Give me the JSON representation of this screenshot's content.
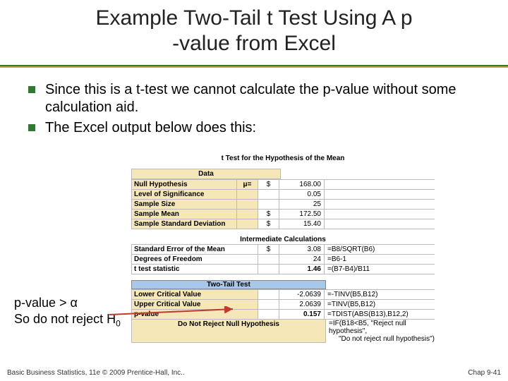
{
  "title_line1": "Example Two-Tail t Test Using A  p",
  "title_line2": "-value from Excel",
  "bullets": [
    "Since this is a t-test we cannot calculate the p-value without some calculation aid.",
    "The Excel output below does this:"
  ],
  "excel": {
    "sec1_title": "t Test for the Hypothesis of the Mean",
    "data_label": "Data",
    "rows1": [
      {
        "label": "Null Hypothesis",
        "sym": "μ=",
        "dollar": "$",
        "val": "168.00",
        "formula": ""
      },
      {
        "label": "Level of Significance",
        "sym": "",
        "dollar": "",
        "val": "0.05",
        "formula": ""
      },
      {
        "label": "Sample Size",
        "sym": "",
        "dollar": "",
        "val": "25",
        "formula": ""
      },
      {
        "label": "Sample Mean",
        "sym": "",
        "dollar": "$",
        "val": "172.50",
        "formula": ""
      },
      {
        "label": "Sample Standard Deviation",
        "sym": "",
        "dollar": "$",
        "val": "15.40",
        "formula": ""
      }
    ],
    "sec2_title": "Intermediate Calculations",
    "rows2": [
      {
        "label": "Standard Error of the Mean",
        "dollar": "$",
        "val": "3.08",
        "formula": "=B8/SQRT(B6)"
      },
      {
        "label": "Degrees of Freedom",
        "dollar": "",
        "val": "24",
        "formula": "=B6-1"
      },
      {
        "label": "t test statistic",
        "dollar": "",
        "val": "1.46",
        "formula": "=(B7-B4)/B11"
      }
    ],
    "sec3_title": "Two-Tail Test",
    "rows3": [
      {
        "label": "Lower Critical Value",
        "dollar": "",
        "val": "-2.0639",
        "formula": "=-TINV(B5,B12)"
      },
      {
        "label": "Upper Critical Value",
        "dollar": "",
        "val": "2.0639",
        "formula": "=TINV(B5,B12)"
      },
      {
        "label": "p-value",
        "dollar": "",
        "val": "0.157",
        "formula": "=TDIST(ABS(B13),B12,2)"
      }
    ],
    "reject_text": "Do Not Reject Null Hypothesis",
    "reject_formula": "=IF(B18<B5, \"Reject null hypothesis\",",
    "reject_formula2": "\"Do not reject null hypothesis\")"
  },
  "pvalue_note_1": "p-value > α",
  "pvalue_note_2_a": "So do not reject H",
  "pvalue_note_2_b": "0",
  "footer_left": "Basic Business Statistics, 11e © 2009 Prentice-Hall, Inc..",
  "footer_right": "Chap 9-41"
}
